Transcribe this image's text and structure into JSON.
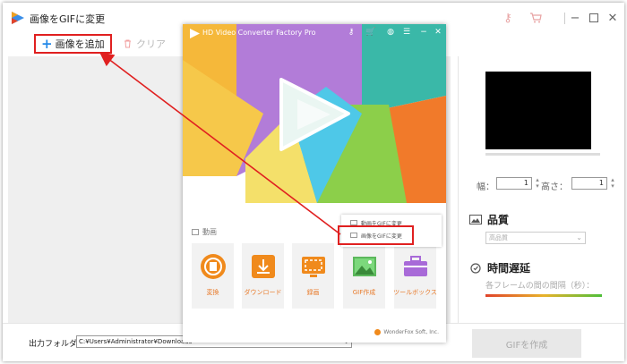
{
  "window": {
    "title": "画像をGIFに変更",
    "icons": [
      "key-icon",
      "cart-icon"
    ],
    "controls": [
      "minimize-icon",
      "maximize-icon",
      "close-icon"
    ]
  },
  "toolbar": {
    "add_image_label": "画像を追加",
    "clear_label": "クリア"
  },
  "right_panel": {
    "width_label": "幅：",
    "width_value": "1",
    "height_label": "高さ：",
    "height_value": "1",
    "quality_title": "品質",
    "quality_select": "高品質",
    "delay_title": "時間遅延",
    "frame_interval_label": "各フレームの間の間隔（秒）："
  },
  "bottom": {
    "output_folder_label": "出力フォルダ：",
    "output_folder_value": "C:¥Users¥Administrator¥Downloads",
    "action_button": "GIFを作成"
  },
  "hd_converter": {
    "title": "HD Video Converter Factory Pro",
    "section_label": "動画",
    "tools": [
      {
        "label": "変換",
        "icon": "film-reel-icon"
      },
      {
        "label": "ダウンロード",
        "icon": "download-icon"
      },
      {
        "label": "録画",
        "icon": "screen-record-icon"
      },
      {
        "label": "GIF作成",
        "icon": "gif-image-icon"
      },
      {
        "label": "ツールボックス",
        "icon": "toolbox-icon"
      }
    ],
    "popup": {
      "item1": "動画をGIFに変更",
      "item2": "画像をGIFに変更"
    },
    "footer": "WonderFox Soft, Inc."
  },
  "colors": {
    "highlight_red": "#e02020",
    "accent_blue": "#2288e8",
    "tool_orange": "#e87a2a"
  }
}
